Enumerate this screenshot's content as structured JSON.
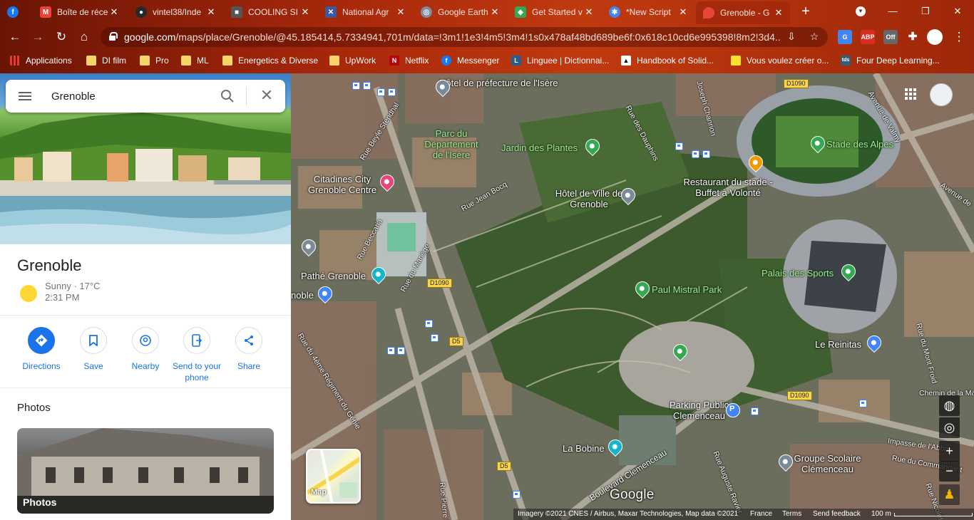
{
  "browser": {
    "tabs": [
      {
        "title": "Boîte de réce",
        "favicon": "facebook-icon",
        "color": "#1877f2"
      },
      {
        "title": "vintel38/Inde",
        "favicon": "gmail-icon",
        "color": "#ea4335"
      },
      {
        "title": "COOLING SI",
        "favicon": "github-icon",
        "color": "#24292e"
      },
      {
        "title": "National Agr",
        "favicon": "cooling-icon",
        "color": "#555555"
      },
      {
        "title": "Google Earth",
        "favicon": "tools-icon",
        "color": "#3b5998"
      },
      {
        "title": "Get Started v",
        "favicon": "earth-icon",
        "color": "#7f8da0"
      },
      {
        "title": "*New Script",
        "favicon": "appscript-icon",
        "color": "#34a853"
      },
      {
        "title": "Grenoble - G",
        "favicon": "maps-icon",
        "color": "#4285f4"
      }
    ],
    "address": {
      "host": "google.com",
      "path": "/maps/place/Grenoble/@45.185414,5.7334941,701m/data=!3m1!1e3!4m5!3m4!1s0x478af48bd689be6f:0x618c10cd6e995398!8m2!3d4..."
    },
    "extensions": [
      {
        "label": "",
        "color": "#4285f4"
      },
      {
        "label": "ABP 2",
        "color": "#d62d20"
      },
      {
        "label": "Off",
        "color": "#666666"
      }
    ],
    "bookmarks": [
      {
        "label": "Applications",
        "icon": "apps-grid-icon"
      },
      {
        "label": "DI film",
        "icon": "folder-icon"
      },
      {
        "label": "Pro",
        "icon": "folder-icon"
      },
      {
        "label": "ML",
        "icon": "folder-icon"
      },
      {
        "label": "Energetics & Diverse",
        "icon": "folder-icon"
      },
      {
        "label": "UpWork",
        "icon": "folder-icon"
      },
      {
        "label": "Netflix",
        "icon": "netflix-icon"
      },
      {
        "label": "Messenger",
        "icon": "facebook-icon"
      },
      {
        "label": "Linguee | Dictionnai...",
        "icon": "linguee-icon"
      },
      {
        "label": "Handbook of Solid...",
        "icon": "handbook-icon"
      },
      {
        "label": "Vous voulez créer o...",
        "icon": "yellow-square-icon"
      },
      {
        "label": "Four Deep Learning...",
        "icon": "tds-icon"
      }
    ]
  },
  "panel": {
    "search_value": "Grenoble",
    "place_title": "Grenoble",
    "weather": {
      "condition": "Sunny · 17°C",
      "time": "2:31 PM"
    },
    "actions": [
      {
        "label": "Directions",
        "icon": "directions-icon"
      },
      {
        "label": "Save",
        "icon": "bookmark-icon"
      },
      {
        "label": "Nearby",
        "icon": "nearby-icon"
      },
      {
        "label": "Send to your phone",
        "icon": "send-to-phone-icon"
      },
      {
        "label": "Share",
        "icon": "share-icon"
      }
    ],
    "photos_heading": "Photos",
    "photo_label": "Photos"
  },
  "map": {
    "pois": {
      "prefecture": "Hôtel de préfecture de l'Isère",
      "parc": "Parc du Département de l'Isère",
      "jardin": "Jardin des Plantes",
      "citadines": "Citadines City Grenoble Centre",
      "hotel_ville": "Hôtel de Ville de Grenoble",
      "restaurant": "Restaurant du stade - Buffet à Volonté",
      "stade": "Stade des Alpes",
      "pathe": "Pathé Grenoble",
      "paul_mistral": "Paul Mistral Park",
      "palais": "Palais des Sports",
      "reinitas": "Le Reinitas",
      "parking": "Parking Public Clemenceau",
      "bobine": "La Bobine",
      "groupe": "Groupe Scolaire Clémenceau",
      "noble": "noble"
    },
    "streets": {
      "beyle": "Rue Beyle Stendhal",
      "dauphins": "Rue des Dauphins",
      "chanrion": "Joseph Chanrion",
      "valmy": "Avenue de Valmy",
      "avenue_de": "Avenue de",
      "jean_bocq": "Rue Jean Bocq",
      "beccaria": "Rue Beccaria",
      "manege": "Rue du Manège",
      "regiment": "Rue du 4ème Régiment du Génie",
      "mont_froid": "Rue du Mont Froid",
      "chemin_made": "Chemin de la Made",
      "impasse": "Impasse de l'Abbay",
      "commandant": "Rue du Commandant",
      "boulevard": "Boulevard Clemenceau",
      "auguste": "Rue Auguste Ravier",
      "pierre": "Rue Pierre L",
      "nicolet": "Rue Nicolet"
    },
    "roads": {
      "d1090_a": "D1090",
      "d1090_b": "D1090",
      "d1090_c": "D1090",
      "d5_a": "D5",
      "d5_b": "D5"
    },
    "layer_label": "Map",
    "google_logo": "Google",
    "footer": {
      "imagery": "Imagery ©2021 CNES / Airbus, Maxar Technologies, Map data ©2021",
      "country": "France",
      "terms": "Terms",
      "feedback": "Send feedback",
      "scale": "100 m"
    },
    "colors": {
      "park_pin": "#34a853",
      "blue_pin": "#4285f4",
      "food_pin": "#f29900",
      "hotel_pin": "#e8457a",
      "teal_pin": "#12b5cb",
      "gray_pin": "#7a8a99"
    }
  }
}
